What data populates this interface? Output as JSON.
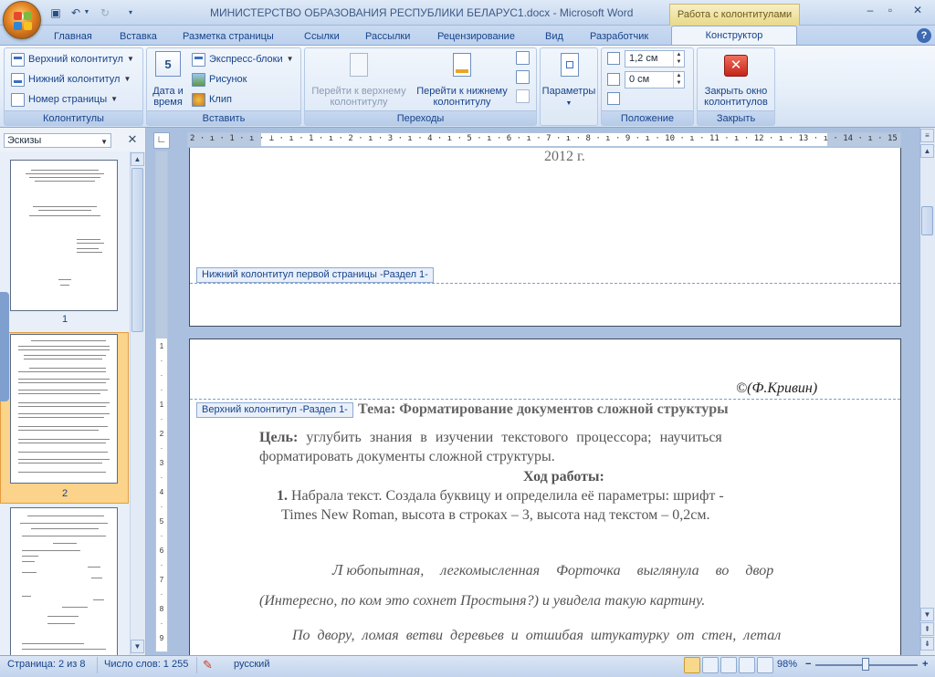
{
  "window": {
    "title": "МИНИСТЕРСТВО ОБРАЗОВАНИЯ РЕСПУБЛИКИ БЕЛАРУС1.docx - Microsoft Word",
    "context_tab_header": "Работа с колонтитулами",
    "minimize": "–",
    "restore": "▫",
    "close": "✕"
  },
  "tabs": [
    "Главная",
    "Вставка",
    "Разметка страницы",
    "Ссылки",
    "Рассылки",
    "Рецензирование",
    "Вид",
    "Разработчик",
    "Конструктор"
  ],
  "active_tab": "Конструктор",
  "ribbon": {
    "kolontituly": {
      "label": "Колонтитулы",
      "header": "Верхний колонтитул",
      "footer": "Нижний колонтитул",
      "page_number": "Номер страницы"
    },
    "vstavit": {
      "label": "Вставить",
      "date_time_line1": "Дата и",
      "date_time_line2": "время",
      "express_blocks": "Экспресс-блоки",
      "picture": "Рисунок",
      "clip": "Клип"
    },
    "perehody": {
      "label": "Переходы",
      "goto_header_line1": "Перейти к верхнему",
      "goto_header_line2": "колонтитулу",
      "goto_footer_line1": "Перейти к нижнему",
      "goto_footer_line2": "колонтитулу"
    },
    "parametry": {
      "label": "Параметры"
    },
    "polozhenie": {
      "label": "Положение",
      "header_offset": "1,2 см",
      "footer_offset": "0 см"
    },
    "zakryt": {
      "label": "Закрыть",
      "close_line1": "Закрыть окно",
      "close_line2": "колонтитулов"
    }
  },
  "left_pane": {
    "title": "Эскизы",
    "close": "✕",
    "thumbs": [
      "1",
      "2"
    ]
  },
  "ruler": {
    "h_text": "2 · ı · 1 · ı · ⊥ · ı · 1 · ı · 2 · ı · 3 · ı · 4 · ı · 5 · ı · 6 · ı · 7 · ı · 8 · ı · 9 · ı · 10 · ı · 11 · ı · 12 · ı · 13 · ı · 14 · ı · 15 · ı · 16 · ı · 17 · ı · 18 · ı",
    "v_ticks": [
      "1",
      "·",
      "·",
      "·",
      "1",
      "·",
      "2",
      "·",
      "3",
      "·",
      "4",
      "·",
      "5",
      "·",
      "6",
      "·",
      "7",
      "·",
      "8",
      "·",
      "9"
    ]
  },
  "document": {
    "page1_year": "2012 г.",
    "footer_label": "Нижний колонтитул первой страницы -Раздел 1-",
    "header_label": "Верхний колонтитул -Раздел 1-",
    "header_text": "©(Ф.Кривин)",
    "topic": "Тема: Форматирование документов сложной структуры",
    "goal_bold": "Цель:",
    "goal_rest_line1": " углубить знания в изучении текстового процессора; научиться",
    "goal_line2": "форматировать документы сложной структуры.",
    "progress_heading": "Ход работы:",
    "item1_num": "1.",
    "item1_line1": "Набрала текст. Создала буквицу и определила её параметры: шрифт -",
    "item1_line2": "Times New Roman, высота в строках – 3, высота над текстом – 0,2см.",
    "italic_dropcap": "Л",
    "italic_line1_rest": "юбопытная, легкомысленная Форточка выглянула во двор",
    "italic_line2": "(Интересно, по ком это сохнет Простыня?) и увидела такую картину.",
    "italic_line3": "По двору, ломая ветви деревьев и отшибая штукатурку от стен, летал"
  },
  "statusbar": {
    "page": "Страница: 2 из 8",
    "words": "Число слов: 1 255",
    "language": "русский",
    "zoom": "98%",
    "zoom_minus": "−",
    "zoom_plus": "+"
  }
}
